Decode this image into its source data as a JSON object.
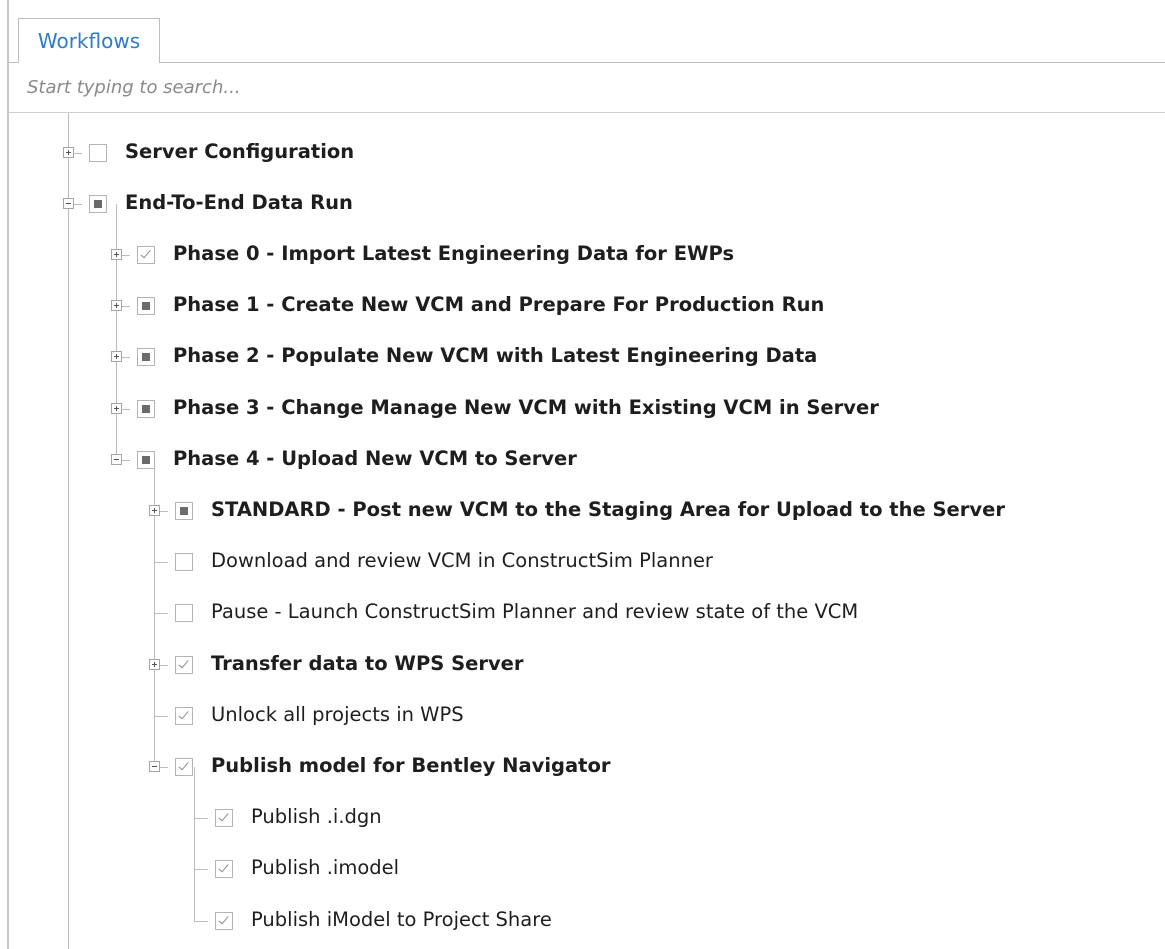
{
  "tab": {
    "label": "Workflows"
  },
  "search": {
    "placeholder": "Start typing to search..."
  },
  "tree": [
    {
      "label": "Server Configuration",
      "bold": true,
      "level": 0,
      "expander": "plus",
      "check": "unchecked"
    },
    {
      "label": "End-To-End Data Run",
      "bold": true,
      "level": 0,
      "expander": "minus",
      "check": "partial"
    },
    {
      "label": "Phase 0 - Import Latest Engineering Data for EWPs",
      "bold": true,
      "level": 1,
      "expander": "plus",
      "check": "checked"
    },
    {
      "label": "Phase 1 - Create New VCM and Prepare For Production Run",
      "bold": true,
      "level": 1,
      "expander": "plus",
      "check": "partial"
    },
    {
      "label": "Phase 2 - Populate New VCM with Latest Engineering Data",
      "bold": true,
      "level": 1,
      "expander": "plus",
      "check": "partial"
    },
    {
      "label": "Phase 3 - Change Manage New VCM with Existing VCM in Server",
      "bold": true,
      "level": 1,
      "expander": "plus",
      "check": "partial"
    },
    {
      "label": "Phase 4 - Upload New VCM to Server",
      "bold": true,
      "level": 1,
      "expander": "minus",
      "check": "partial"
    },
    {
      "label": "STANDARD - Post new VCM to the Staging Area for Upload to the Server",
      "bold": true,
      "level": 2,
      "expander": "plus",
      "check": "partial"
    },
    {
      "label": "Download and review VCM in ConstructSim Planner",
      "bold": false,
      "level": 2,
      "expander": "none",
      "check": "unchecked"
    },
    {
      "label": "Pause - Launch ConstructSim Planner and review state of the VCM",
      "bold": false,
      "level": 2,
      "expander": "none",
      "check": "unchecked"
    },
    {
      "label": "Transfer data to WPS Server",
      "bold": true,
      "level": 2,
      "expander": "plus",
      "check": "checked"
    },
    {
      "label": "Unlock all projects in WPS",
      "bold": false,
      "level": 2,
      "expander": "none",
      "check": "checked"
    },
    {
      "label": "Publish model for Bentley Navigator",
      "bold": true,
      "level": 2,
      "expander": "minus",
      "check": "checked"
    },
    {
      "label": "Publish .i.dgn",
      "bold": false,
      "level": 3,
      "expander": "none",
      "check": "checked"
    },
    {
      "label": "Publish .imodel",
      "bold": false,
      "level": 3,
      "expander": "none",
      "check": "checked"
    },
    {
      "label": "Publish iModel to Project Share",
      "bold": false,
      "level": 3,
      "expander": "none",
      "check": "checked"
    }
  ]
}
